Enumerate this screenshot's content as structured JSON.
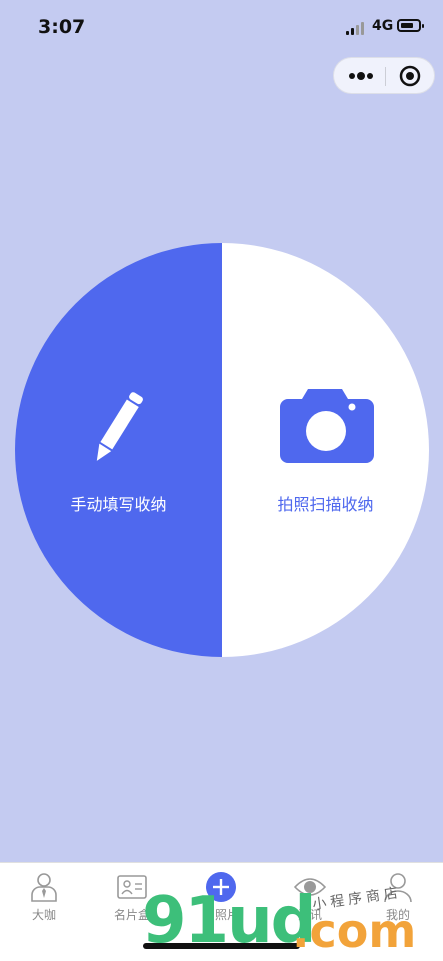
{
  "status": {
    "time": "3:07",
    "network": "4G"
  },
  "capsule": {
    "more_icon": "more-dots-icon",
    "close_icon": "target-close-icon"
  },
  "colors": {
    "background": "#c4cbf1",
    "accent": "#4f68ee",
    "white": "#ffffff",
    "tab_text": "#888888"
  },
  "actions": {
    "manual": {
      "label": "手动填写收纳",
      "icon": "pencil-icon"
    },
    "scan": {
      "label": "拍照扫描收纳",
      "icon": "camera-icon"
    }
  },
  "tabs": [
    {
      "label": "大咖",
      "icon": "person-tie-icon"
    },
    {
      "label": "名片盒",
      "icon": "card-box-icon"
    },
    {
      "label": "拍照片",
      "icon": "plus-circle-icon"
    },
    {
      "label": "资讯",
      "icon": "eye-icon"
    },
    {
      "label": "我的",
      "icon": "user-icon"
    }
  ],
  "watermark": {
    "main": "91ud",
    "suffix": ".com",
    "cn": "小程序商店"
  }
}
